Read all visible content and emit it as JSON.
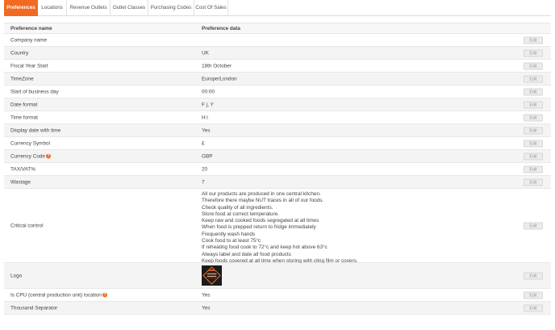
{
  "tabs": [
    "Preferences",
    "Locations",
    "Revenue Outlets",
    "Outlet Classes",
    "Purchasing Codes",
    "Cost Of Sales"
  ],
  "table": {
    "header_name": "Preference name",
    "header_data": "Preference data",
    "edit_label": "Edit",
    "rows": [
      {
        "name": "Company name",
        "value": ""
      },
      {
        "name": "Country",
        "value": "UK"
      },
      {
        "name": "Fiscal Year Start",
        "value": "18th October"
      },
      {
        "name": "TimeZone",
        "value": "Europe/London"
      },
      {
        "name": "Start of business day",
        "value": "00:00"
      },
      {
        "name": "Date format",
        "value": "F j, Y"
      },
      {
        "name": "Time format",
        "value": "H:i"
      },
      {
        "name": "Display date with time",
        "value": "Yes"
      },
      {
        "name": "Currency Symbol",
        "value": "£"
      },
      {
        "name": "Currency Code",
        "value": "GBP",
        "help": true
      },
      {
        "name": "TAX/VAT%",
        "value": "20"
      },
      {
        "name": "Wastage",
        "value": "7"
      },
      {
        "name": "Critical control",
        "lines": [
          "All our products are produced in one central kitchen.",
          "Therefore there maybe NUT traces in all of our foods.",
          "Check quality of all ingredients.",
          "Store food at correct temperature.",
          "Keep raw and cooked foods segregated at all times",
          "When food is prepped return to fridge immediately",
          "Frequently wash hands",
          "Cook food to at least 75°c",
          "If reheating food cook to 72°c and keep hot above 63°c",
          "Always label and date all food products",
          "Keep foods covered at all time when storing with cling film or covers."
        ]
      },
      {
        "name": "Logo",
        "logo": true
      },
      {
        "name": "Is CPU (central production unit) location",
        "value": "Yes",
        "help": true
      },
      {
        "name": "Thousand Separator",
        "value": "Yes"
      }
    ]
  },
  "colors": {
    "accent": "#f26a21"
  },
  "icons": {
    "help": "question-circle-icon"
  }
}
